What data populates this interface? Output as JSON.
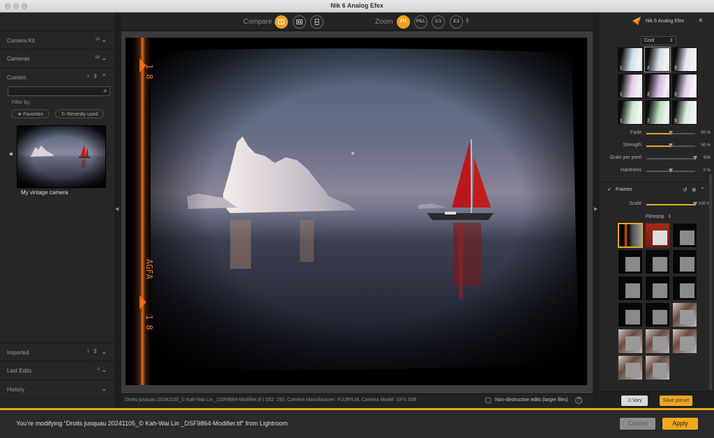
{
  "window": {
    "title": "Nik 6 Analog Efex"
  },
  "left_panel": {
    "sections_top": [
      {
        "label": "Camera Kit",
        "count": "14"
      },
      {
        "label": "Cameras",
        "count": "96"
      },
      {
        "label": "Custom",
        "count": "1"
      }
    ],
    "search": {
      "placeholder": "",
      "value": ""
    },
    "filter_by_label": "Filter by:",
    "filters": [
      "Favorites",
      "Recently used"
    ],
    "custom_item": {
      "label": "My vintage camera"
    },
    "sections_bottom": [
      {
        "label": "Imported",
        "count": "1"
      },
      {
        "label": "Last Edits",
        "count": "0"
      },
      {
        "label": "History",
        "count": ""
      }
    ]
  },
  "toolbar": {
    "compare_label": "Compare",
    "zoom_label": "Zoom",
    "zoom_options": [
      "FIT",
      "FILL",
      "1:1",
      "2:1"
    ],
    "zoom_active": "FIT"
  },
  "status_bar": {
    "file_info": "Droits jusquau 20241105_© Kah-Wai Lin _DSF9864-Modifier.tif   |   ISO: 250, Camera Manufacturer: FUJIFILM, Camera Model: GFX 50R",
    "non_destructive_label": "Non-destructive edits (larger files)",
    "non_destructive_checked": false,
    "help": "?"
  },
  "right_panel": {
    "brand": "Nik 6 Analog Efex",
    "tone_preset": "Cool",
    "tone_thumbs": [
      "1",
      "2",
      "3",
      "1",
      "2",
      "3",
      "1",
      "2",
      "3"
    ],
    "sliders": [
      {
        "label": "Fade",
        "value": "50 %",
        "fraction": 0.5
      },
      {
        "label": "Strength",
        "value": "50 %",
        "fraction": 0.5
      },
      {
        "label": "Grain per pixel",
        "value": "500",
        "fraction": 1.0
      },
      {
        "label": "Hardness",
        "value": "0 %",
        "fraction": 0.5
      }
    ],
    "frames": {
      "label": "Frames",
      "enabled": true,
      "scale_label": "Scale",
      "scale_value": "100 %",
      "scale_fraction": 1.0,
      "type": "Filmstrip"
    },
    "vary_label": "Vary",
    "save_preset_label": "Save preset"
  },
  "footer": {
    "message": "You’re modifying “Droits jusquau 20241105_© Kah-Wai Lin _DSF9864-Modifier.tif” from Lightroom",
    "cancel_label": "Cancel",
    "apply_label": "Apply"
  },
  "colors": {
    "accent": "#efa51d"
  }
}
